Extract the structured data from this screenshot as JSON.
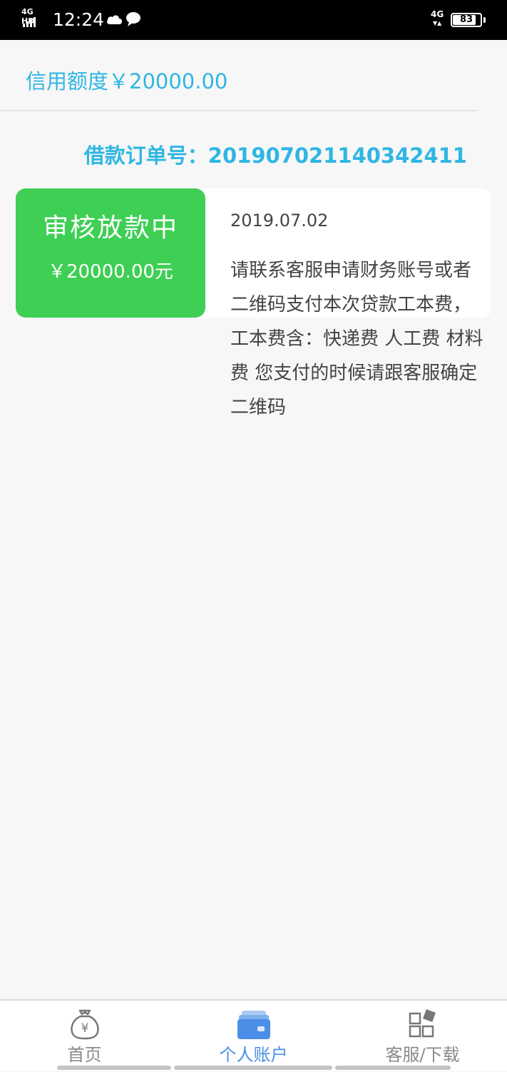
{
  "status_bar": {
    "network_label": "4G HD",
    "time": "12:24",
    "mobile_data": "4G",
    "battery": "83",
    "battery_level": 0.83
  },
  "credit": {
    "label": "信用额度￥20000.00"
  },
  "order": {
    "label": "借款订单号：20190702114034​2411"
  },
  "card": {
    "status_title": "审核放款中",
    "amount": "￥20000.00元",
    "date": "2019.07.02",
    "notice": "请联系客服申请财务账号或者二维码支付本次贷款工本费，工本费含：快递费 人工费 材料费 您支付的时候请跟客服确定二维码"
  },
  "tabbar": {
    "items": [
      {
        "label": "首页",
        "icon": "money-bag-icon",
        "active": false
      },
      {
        "label": "个人账户",
        "icon": "wallet-icon",
        "active": true
      },
      {
        "label": "客服/下载",
        "icon": "apps-grid-icon",
        "active": false
      }
    ]
  },
  "colors": {
    "accent": "#2fb6e3",
    "status_green": "#3ecf54",
    "tab_active": "#4a8ee8",
    "tab_inactive": "#8a8a8a"
  }
}
